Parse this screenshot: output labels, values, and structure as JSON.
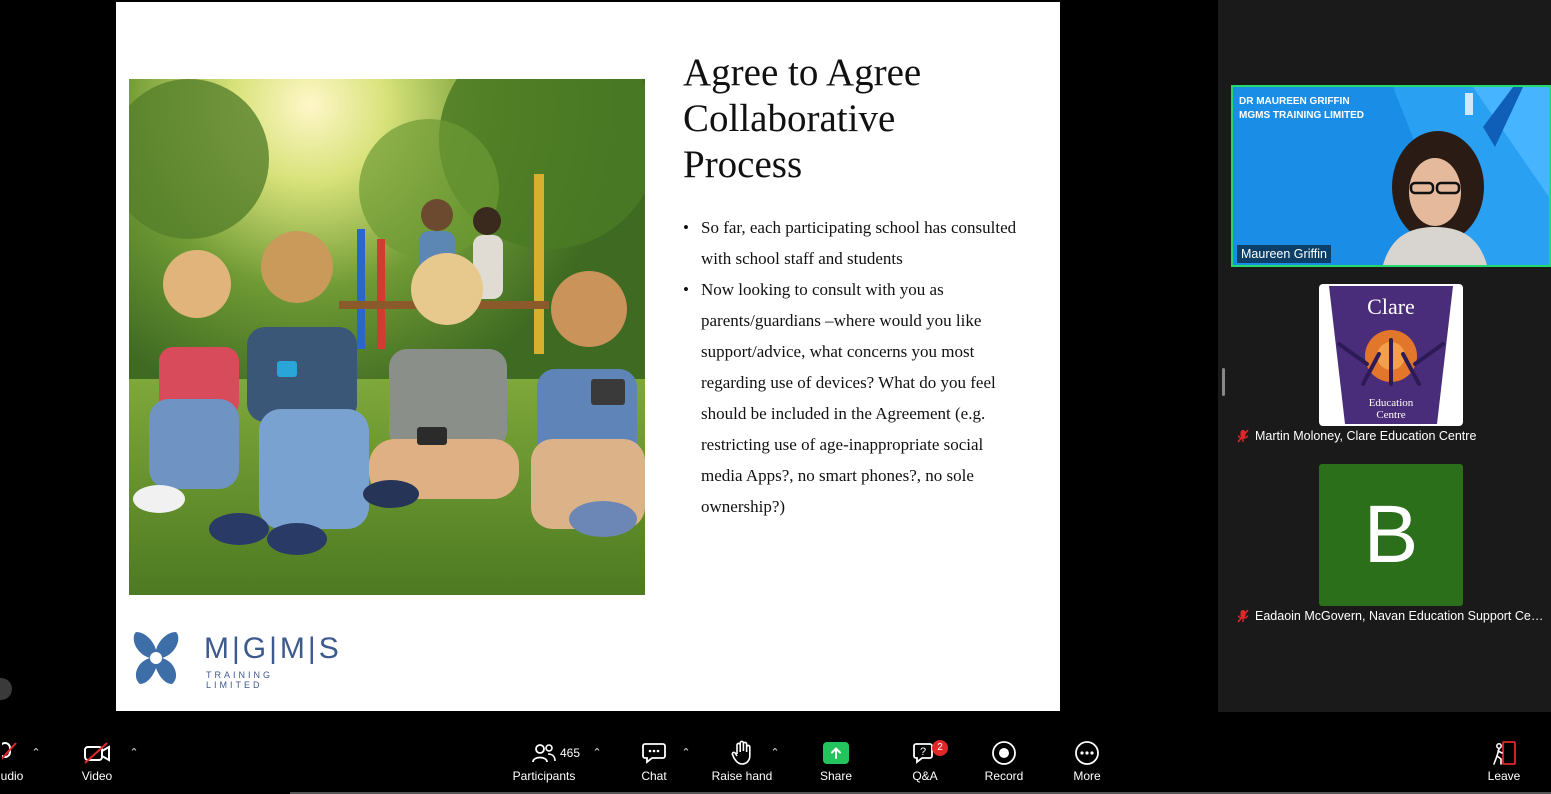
{
  "slide": {
    "title": "Agree to Agree Collaborative Process",
    "bullets": [
      "So far, each participating school has consulted with school staff and students",
      "Now looking to consult with you as parents/guardians –where would you like support/advice, what concerns you most regarding use of devices? What do you feel should be included in the Agreement (e.g. restricting use of age-inappropriate social media Apps?, no smart phones?, no sole ownership?)"
    ],
    "logo": {
      "name": "M|G|M|S",
      "sub": "TRAINING LIMITED"
    }
  },
  "gallery": {
    "speaker": {
      "banner_line1": "DR MAUREEN GRIFFIN",
      "banner_line2": "MGMS TRAINING LIMITED",
      "name": "Maureen Griffin"
    },
    "tile2": {
      "logo_title": "Clare",
      "logo_sub1": "Education",
      "logo_sub2": "Centre",
      "name": "Martin Moloney, Clare Education Centre"
    },
    "tile3": {
      "avatar_letter": "B",
      "name": "Eadaoin McGovern, Navan Education Support Centre"
    }
  },
  "toolbar": {
    "audio_label": "udio",
    "video_label": "Video",
    "participants_label": "Participants",
    "participants_count": "465",
    "chat_label": "Chat",
    "raise_hand_label": "Raise hand",
    "share_label": "Share",
    "qa_label": "Q&A",
    "qa_badge": "2",
    "record_label": "Record",
    "more_label": "More",
    "leave_label": "Leave"
  },
  "colors": {
    "speaker_border": "#23d96c",
    "share_green": "#23c45e",
    "badge_red": "#e02828",
    "avatar_green": "#2c6f1b",
    "logo_blue": "#3d5a8f"
  }
}
